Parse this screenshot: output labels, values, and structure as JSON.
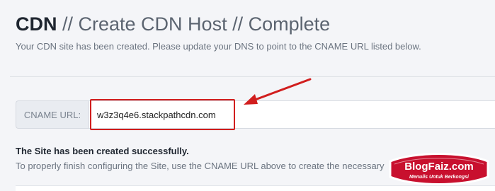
{
  "header": {
    "breadcrumb_root": "CDN",
    "breadcrumb_sep1": " // ",
    "breadcrumb_step": "Create CDN Host",
    "breadcrumb_sep2": " // ",
    "breadcrumb_current": "Complete",
    "subtitle": "Your CDN site has been created. Please update your DNS to point to the CNAME URL listed below."
  },
  "cname": {
    "label": "CNAME URL:",
    "value": "w3z3q4e6.stackpathcdn.com"
  },
  "success": {
    "title": "The Site has been created successfully.",
    "text": "To properly finish configuring the Site, use the CNAME URL above to create the necessary"
  },
  "watermark": {
    "brand": "BlogFaiz.com",
    "tagline": "Menulis Untuk Berkongsi"
  },
  "annotation_colors": {
    "highlight": "#d11e1e"
  }
}
